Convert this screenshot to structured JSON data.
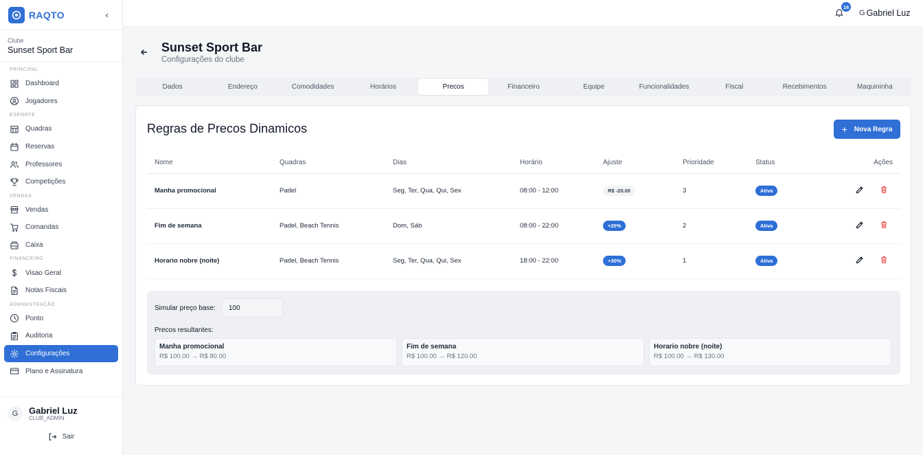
{
  "brand": {
    "name": "RAQTO"
  },
  "club": {
    "label": "Clube",
    "name": "Sunset Sport Bar"
  },
  "sidebar": {
    "sections": [
      {
        "title": "PRINCIPAL",
        "items": [
          {
            "label": "Dashboard",
            "icon": "dashboard-icon"
          },
          {
            "label": "Jogadores",
            "icon": "user-circle-icon"
          }
        ]
      },
      {
        "title": "ESPORTE",
        "items": [
          {
            "label": "Quadras",
            "icon": "building-icon"
          },
          {
            "label": "Reservas",
            "icon": "calendar-icon"
          },
          {
            "label": "Professores",
            "icon": "users-icon"
          },
          {
            "label": "Competições",
            "icon": "trophy-icon"
          }
        ]
      },
      {
        "title": "VENDAS",
        "items": [
          {
            "label": "Vendas",
            "icon": "store-icon"
          },
          {
            "label": "Comandas",
            "icon": "cart-icon"
          },
          {
            "label": "Caixa",
            "icon": "cash-register-icon"
          }
        ]
      },
      {
        "title": "FINANCEIRO",
        "items": [
          {
            "label": "Visao Geral",
            "icon": "dollar-icon"
          },
          {
            "label": "Notas Fiscais",
            "icon": "document-icon"
          }
        ]
      },
      {
        "title": "ADMINISTRAÇÃO",
        "items": [
          {
            "label": "Ponto",
            "icon": "clock-icon"
          },
          {
            "label": "Auditoria",
            "icon": "clipboard-icon"
          },
          {
            "label": "Configurações",
            "icon": "gear-icon",
            "active": true
          },
          {
            "label": "Plano e Assinatura",
            "icon": "credit-card-icon"
          }
        ]
      }
    ]
  },
  "user": {
    "initial": "G",
    "name": "Gabriel Luz",
    "role": "CLUB_ADMIN",
    "logout_label": "Sair"
  },
  "topbar": {
    "notification_count": "16",
    "user_initial": "G",
    "user_name": "Gabriel Luz"
  },
  "header": {
    "title": "Sunset Sport Bar",
    "subtitle": "Configurações do clube"
  },
  "tabs": [
    "Dados",
    "Endereço",
    "Comodidades",
    "Horários",
    "Precos",
    "Financeiro",
    "Equipe",
    "Funcionalidades",
    "Fiscal",
    "Recebimentos",
    "Maquininha"
  ],
  "active_tab": "Precos",
  "rules": {
    "title": "Regras de Precos Dinamicos",
    "new_button": "Nova Regra",
    "columns": [
      "Nome",
      "Quadras",
      "Dias",
      "Horário",
      "Ajuste",
      "Prioridade",
      "Status",
      "Ações"
    ],
    "rows": [
      {
        "name": "Manha promocional",
        "courts": "Padel",
        "days": "Seg, Ter, Qua, Qui, Sex",
        "time": "08:00 - 12:00",
        "adjust": "R$ -20.00",
        "adjust_type": "neg",
        "priority": "3",
        "status": "Ativa"
      },
      {
        "name": "Fim de semana",
        "courts": "Padel, Beach Tennis",
        "days": "Dom, Sáb",
        "time": "08:00 - 22:00",
        "adjust": "+20%",
        "adjust_type": "pos",
        "priority": "2",
        "status": "Ativa"
      },
      {
        "name": "Horario nobre (noite)",
        "courts": "Padel, Beach Tennis",
        "days": "Seg, Ter, Qua, Qui, Sex",
        "time": "18:00 - 22:00",
        "adjust": "+30%",
        "adjust_type": "pos",
        "priority": "1",
        "status": "Ativa"
      }
    ]
  },
  "simulator": {
    "label": "Simular preço base:",
    "value": "100",
    "results_label": "Precos resultantes:",
    "results": [
      {
        "name": "Manha promocional",
        "value": "R$ 100.00 → R$ 80.00"
      },
      {
        "name": "Fim de semana",
        "value": "R$ 100.00 → R$ 120.00"
      },
      {
        "name": "Horario nobre (noite)",
        "value": "R$ 100.00 → R$ 130.00"
      }
    ]
  },
  "colors": {
    "accent": "#2f6fd6",
    "delete": "#ef4444"
  }
}
